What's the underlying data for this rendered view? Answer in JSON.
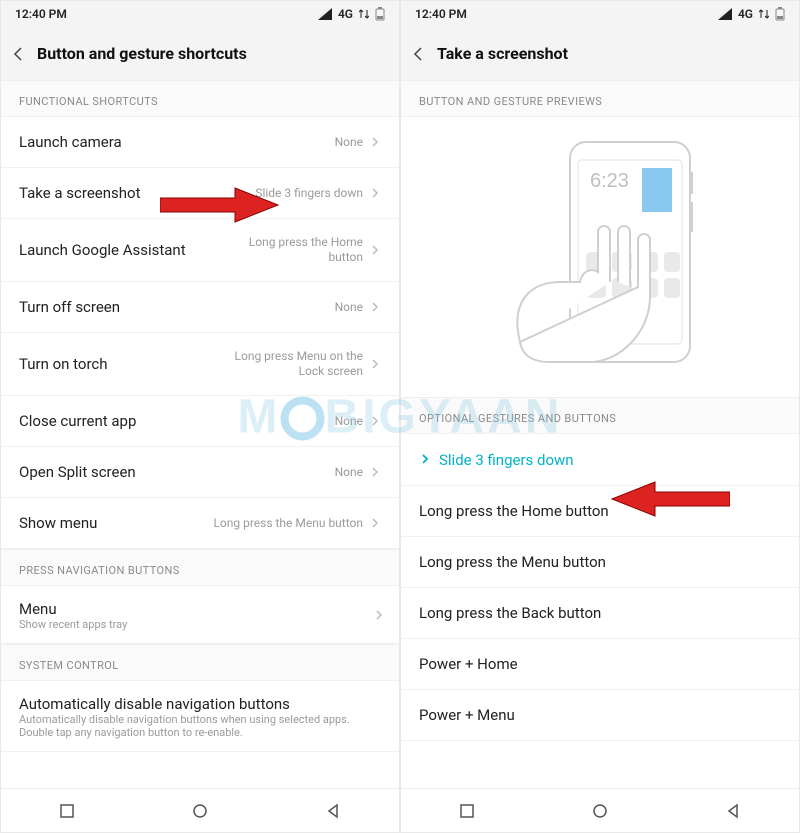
{
  "statusbar": {
    "time": "12:40 PM",
    "network": "4G"
  },
  "left": {
    "title": "Button and gesture shortcuts",
    "sections": {
      "functional": {
        "header": "FUNCTIONAL SHORTCUTS",
        "items": [
          {
            "label": "Launch camera",
            "value": "None"
          },
          {
            "label": "Take a screenshot",
            "value": "Slide 3 fingers down"
          },
          {
            "label": "Launch Google Assistant",
            "value": "Long press the Home button"
          },
          {
            "label": "Turn off screen",
            "value": "None"
          },
          {
            "label": "Turn on torch",
            "value": "Long press Menu on the Lock screen"
          },
          {
            "label": "Close current app",
            "value": "None"
          },
          {
            "label": "Open Split screen",
            "value": "None"
          },
          {
            "label": "Show menu",
            "value": "Long press the Menu button"
          }
        ]
      },
      "pressnav": {
        "header": "PRESS NAVIGATION BUTTONS",
        "menu": {
          "label": "Menu",
          "sub": "Show recent apps tray"
        }
      },
      "system": {
        "header": "SYSTEM CONTROL",
        "auto": {
          "label": "Automatically disable navigation buttons",
          "sub": "Automatically disable navigation buttons when using selected apps. Double tap any navigation button to re-enable."
        }
      }
    }
  },
  "right": {
    "title": "Take a screenshot",
    "previewHeader": "BUTTON AND GESTURE PREVIEWS",
    "previewTime": "6:23",
    "optionsHeader": "OPTIONAL GESTURES AND BUTTONS",
    "options": [
      {
        "label": "Slide 3 fingers down",
        "selected": true
      },
      {
        "label": "Long press the Home button"
      },
      {
        "label": "Long press the Menu button"
      },
      {
        "label": "Long press the Back button"
      },
      {
        "label": "Power + Home"
      },
      {
        "label": "Power + Menu"
      }
    ]
  },
  "watermark": "MOBIGYAAN"
}
